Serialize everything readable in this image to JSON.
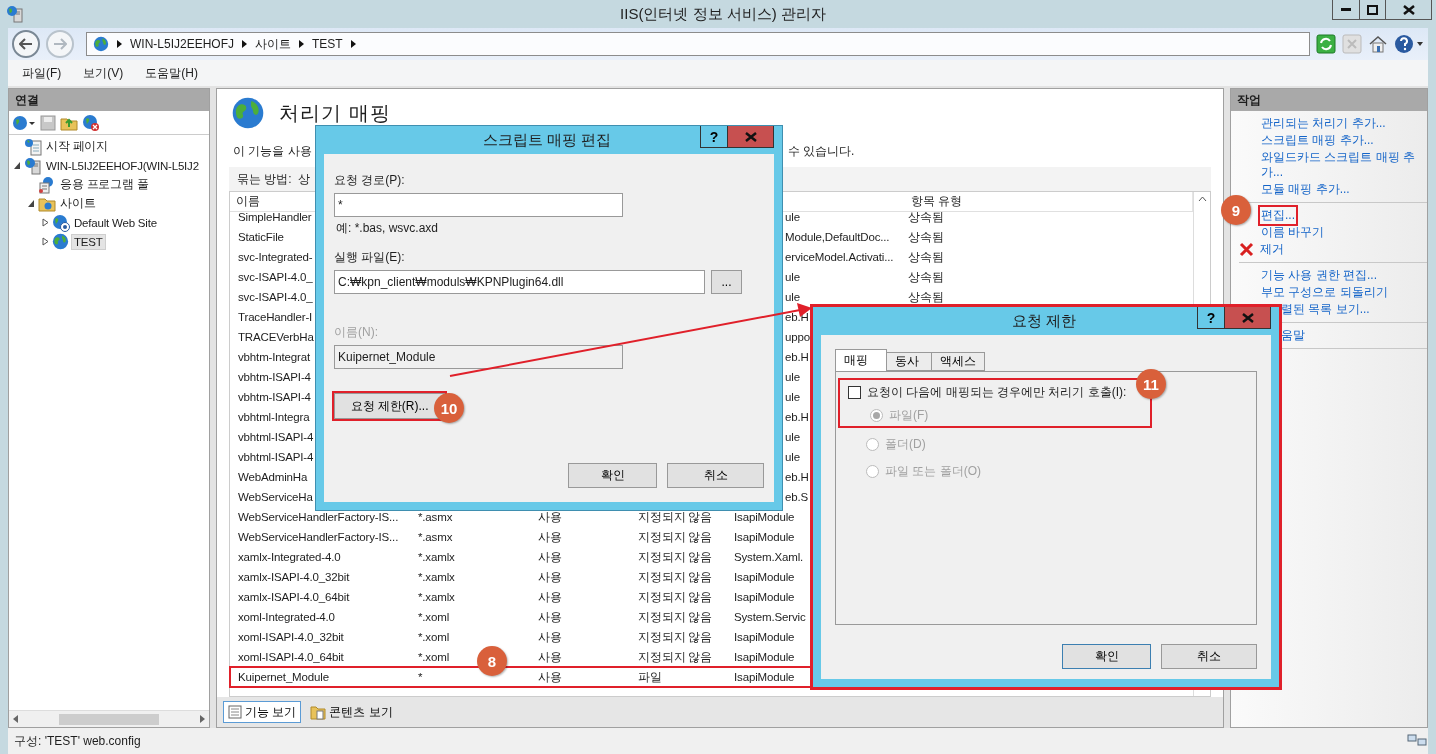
{
  "window": {
    "title": "IIS(인터넷 정보 서비스) 관리자"
  },
  "address_bar": {
    "crumbs": [
      "WIN-L5IJ2EEHOFJ",
      "사이트",
      "TEST"
    ]
  },
  "menu": [
    "파일(F)",
    "보기(V)",
    "도움말(H)"
  ],
  "connections": {
    "title": "연결",
    "tree": [
      {
        "kind": "start",
        "label": "시작 페이지",
        "selected": false
      },
      {
        "kind": "server",
        "label": "WIN-L5IJ2EEHOFJ(WIN-L5IJ2",
        "selected": false,
        "expanded": true,
        "children": [
          {
            "kind": "pool",
            "label": "응용 프로그램 풀",
            "selected": false
          },
          {
            "kind": "sites",
            "label": "사이트",
            "selected": false,
            "expanded": true,
            "children": [
              {
                "kind": "site_help",
                "label": "Default Web Site",
                "selected": false,
                "expanded": false
              },
              {
                "kind": "site",
                "label": "TEST",
                "selected": true,
                "expanded": false
              }
            ]
          }
        ]
      }
    ]
  },
  "feature": {
    "title": "처리기 매핑",
    "description_left": "이 기능을 사용",
    "description_right": "수 있습니다.",
    "group_by_label": "묶는 방법:",
    "group_by_value": "상",
    "columns": [
      {
        "label": "이름"
      },
      {
        "label": "항목 유형"
      }
    ],
    "rows": [
      {
        "kind": "covered",
        "name": "SimpleHandler",
        "handler": "ule",
        "entry_type": "상속됨"
      },
      {
        "kind": "covered",
        "name": "StaticFile",
        "handler": "Module,DefaultDoc...",
        "entry_type": "상속됨"
      },
      {
        "kind": "covered",
        "name": "svc-Integrated-",
        "handler": "erviceModel.Activati...",
        "entry_type": "상속됨"
      },
      {
        "kind": "covered",
        "name": "svc-ISAPI-4.0_",
        "handler": "ule",
        "entry_type": "상속됨"
      },
      {
        "kind": "covered",
        "name": "svc-ISAPI-4.0_",
        "handler": "ule",
        "entry_type": "상속됨"
      },
      {
        "kind": "covered",
        "name": "TraceHandler-I",
        "handler": "eb.H"
      },
      {
        "kind": "covered",
        "name": "TRACEVerbHa",
        "handler": "uppo"
      },
      {
        "kind": "covered",
        "name": "vbhtm-Integrat",
        "handler": "eb.H"
      },
      {
        "kind": "covered",
        "name": "vbhtm-ISAPI-4",
        "handler": "ule"
      },
      {
        "kind": "covered",
        "name": "vbhtm-ISAPI-4",
        "handler": "ule"
      },
      {
        "kind": "covered",
        "name": "vbhtml-Integra",
        "handler": "eb.H"
      },
      {
        "kind": "covered",
        "name": "vbhtml-ISAPI-4",
        "handler": "ule"
      },
      {
        "kind": "covered",
        "name": "vbhtml-ISAPI-4",
        "handler": "ule"
      },
      {
        "kind": "covered",
        "name": "WebAdminHa",
        "handler": "eb.H"
      },
      {
        "kind": "covered",
        "name": "WebServiceHa",
        "handler": "eb.S"
      },
      {
        "kind": "full",
        "name": "WebServiceHandlerFactory-IS...",
        "path": "*.asmx",
        "state": "사용",
        "path_type": "지정되지 않음",
        "handler": "IsapiModule",
        "highlighted": false
      },
      {
        "kind": "full",
        "name": "WebServiceHandlerFactory-IS...",
        "path": "*.asmx",
        "state": "사용",
        "path_type": "지정되지 않음",
        "handler": "IsapiModule",
        "highlighted": false
      },
      {
        "kind": "full",
        "name": "xamlx-Integrated-4.0",
        "path": "*.xamlx",
        "state": "사용",
        "path_type": "지정되지 않음",
        "handler": "System.Xaml.",
        "highlighted": false
      },
      {
        "kind": "full",
        "name": "xamlx-ISAPI-4.0_32bit",
        "path": "*.xamlx",
        "state": "사용",
        "path_type": "지정되지 않음",
        "handler": "IsapiModule",
        "highlighted": false
      },
      {
        "kind": "full",
        "name": "xamlx-ISAPI-4.0_64bit",
        "path": "*.xamlx",
        "state": "사용",
        "path_type": "지정되지 않음",
        "handler": "IsapiModule",
        "highlighted": false
      },
      {
        "kind": "full",
        "name": "xoml-Integrated-4.0",
        "path": "*.xoml",
        "state": "사용",
        "path_type": "지정되지 않음",
        "handler": "System.Servic",
        "highlighted": false
      },
      {
        "kind": "full",
        "name": "xoml-ISAPI-4.0_32bit",
        "path": "*.xoml",
        "state": "사용",
        "path_type": "지정되지 않음",
        "handler": "IsapiModule",
        "highlighted": false
      },
      {
        "kind": "full",
        "name": "xoml-ISAPI-4.0_64bit",
        "path": "*.xoml",
        "state": "사용",
        "path_type": "지정되지 않음",
        "handler": "IsapiModule",
        "highlighted": false
      },
      {
        "kind": "full",
        "name": "Kuipernet_Module",
        "path": "*",
        "state": "사용",
        "path_type": "파일",
        "handler": "IsapiModule",
        "highlighted": true
      }
    ],
    "view_tabs": [
      {
        "label": "기능 보기",
        "selected": true
      },
      {
        "label": "콘텐츠 보기",
        "selected": false
      }
    ]
  },
  "actions": {
    "title": "작업",
    "groups": [
      [
        {
          "kind": "link",
          "label": "관리되는 처리기 추가...",
          "highlighted": false
        },
        {
          "kind": "link",
          "label": "스크립트 매핑 추가...",
          "highlighted": false
        },
        {
          "kind": "link",
          "label": "와일드카드 스크립트 매핑 추가...",
          "highlighted": false
        },
        {
          "kind": "link",
          "label": "모듈 매핑 추가...",
          "highlighted": false
        }
      ],
      [
        {
          "kind": "link",
          "label": "편집...",
          "highlighted": true
        },
        {
          "kind": "link",
          "label": "이름 바꾸기",
          "highlighted": false
        },
        {
          "kind": "remove",
          "label": "제거",
          "highlighted": false
        }
      ],
      [
        {
          "kind": "link",
          "label": "기능 사용 권한 편집...",
          "highlighted": false
        },
        {
          "kind": "link",
          "label": "부모 구성으로 되돌리기",
          "highlighted": false
        },
        {
          "kind": "covered",
          "label": "렬된 목록 보기...",
          "highlighted": false
        }
      ],
      [
        {
          "kind": "covered",
          "label": "움말",
          "highlighted": false
        }
      ]
    ]
  },
  "edit_dialog": {
    "title": "스크립트 매핑 편집",
    "help": "?",
    "path_label": "요청 경로(P):",
    "path_value": "*",
    "path_hint": "예: *.bas, wsvc.axd",
    "exe_label": "실행 파일(E):",
    "exe_value": "C:₩kpn_client₩moduls₩KPNPlugin64.dll",
    "browse": "...",
    "name_label": "이름(N):",
    "name_value": "Kuipernet_Module",
    "name_disabled": true,
    "restrict_button": "요청 제한(R)...",
    "restrict_highlighted": true,
    "ok": "확인",
    "cancel": "취소"
  },
  "restrict_dialog": {
    "title": "요청 제한",
    "help": "?",
    "highlighted": true,
    "tabs": [
      {
        "label": "매핑",
        "selected": true
      },
      {
        "label": "동사",
        "selected": false
      },
      {
        "label": "액세스",
        "selected": false
      }
    ],
    "checkbox": {
      "label": "요청이 다음에 매핑되는 경우에만 처리기 호출(I):",
      "checked": false,
      "highlighted": true
    },
    "radios": [
      {
        "label": "파일(F)",
        "selected": true,
        "disabled": true
      },
      {
        "label": "폴더(D)",
        "selected": false,
        "disabled": true
      },
      {
        "label": "파일 또는 폴더(O)",
        "selected": false,
        "disabled": true
      }
    ],
    "ok": "확인",
    "cancel": "취소"
  },
  "annotations": [
    {
      "number": "8"
    },
    {
      "number": "9"
    },
    {
      "number": "10"
    },
    {
      "number": "11"
    }
  ],
  "status_bar": "구성: 'TEST' web.config"
}
